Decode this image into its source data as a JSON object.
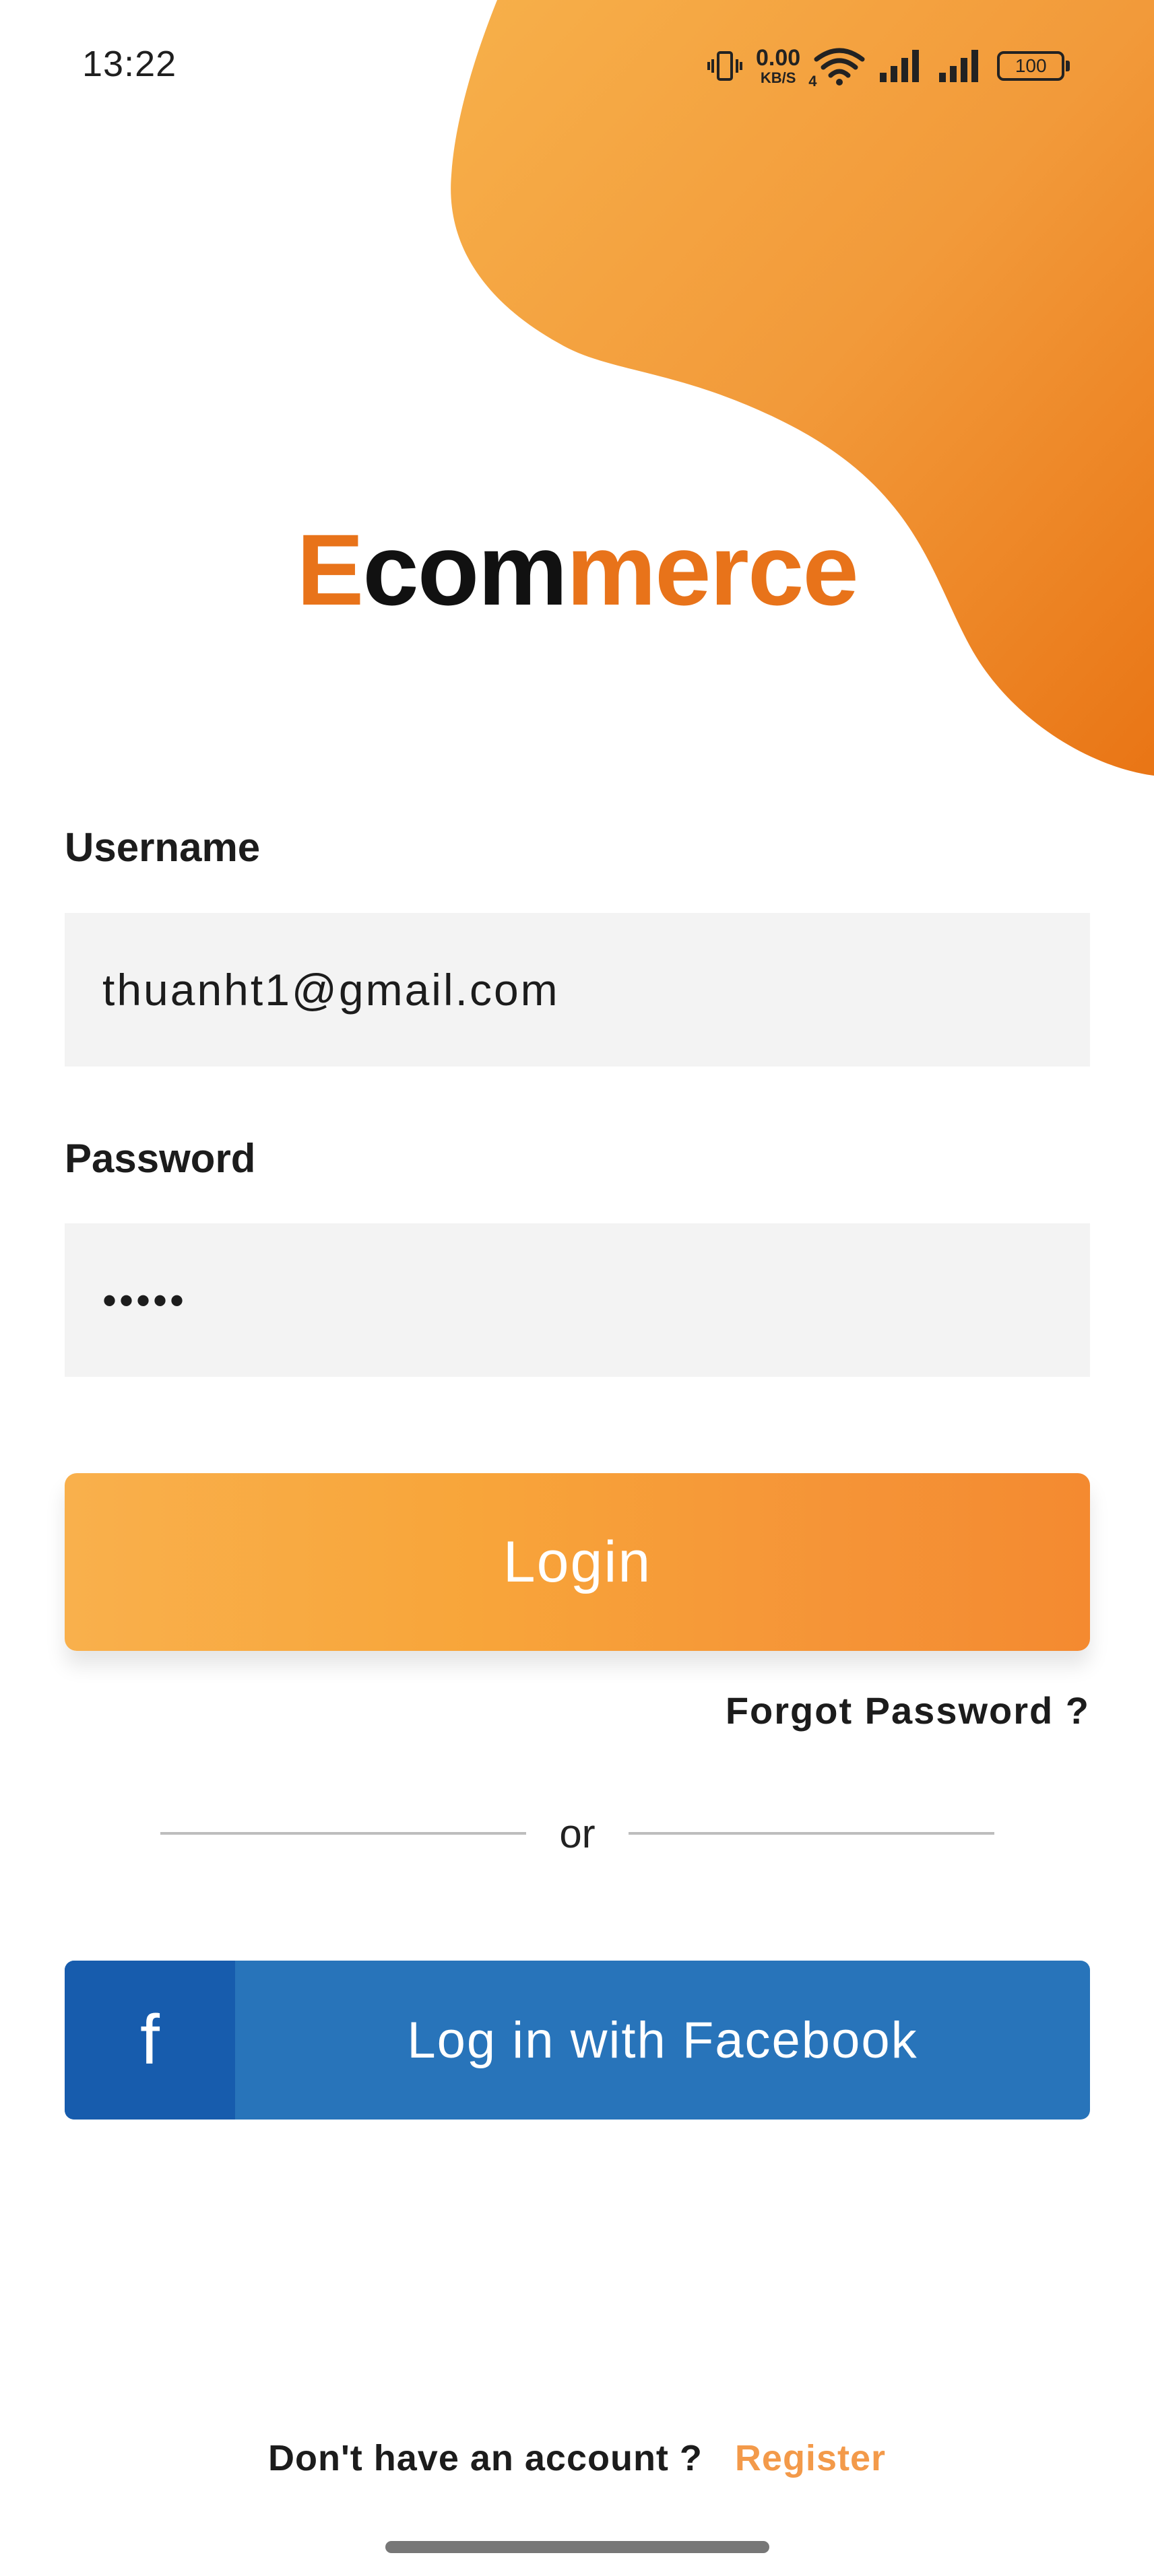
{
  "status_bar": {
    "time": "13:22",
    "net_speed_value": "0.00",
    "net_speed_unit": "KB/S",
    "network_type": "4",
    "battery": "100",
    "icons": [
      "vibrate-icon",
      "wifi-icon",
      "signal-icon",
      "signal-icon",
      "battery-icon"
    ]
  },
  "logo": {
    "part1": "E",
    "part2": "com",
    "part3": "merce"
  },
  "form": {
    "username_label": "Username",
    "username_value": "thuanht1@gmail.com",
    "password_label": "Password",
    "password_value": "•••••"
  },
  "login_button": "Login",
  "forgot_password": "Forgot Password ?",
  "divider_text": "or",
  "facebook": {
    "icon": "f",
    "label": "Log in with Facebook"
  },
  "footer": {
    "question": "Don't have an account ?",
    "register": "Register"
  },
  "colors": {
    "accent": "#e8731a",
    "login_gradient_start": "#f9b04c",
    "login_gradient_end": "#f48a30",
    "facebook_blue": "#2874ba",
    "facebook_dark": "#175cad",
    "register_link": "#f39a4a"
  }
}
